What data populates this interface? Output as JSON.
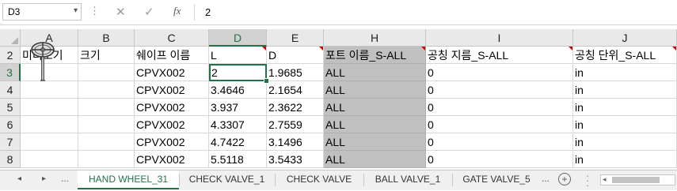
{
  "formula_bar": {
    "name_box": "D3",
    "name_box_arrow": "▾",
    "cancel_icon": "✕",
    "enter_icon": "✓",
    "fx_label": "fx",
    "formula_value": "2"
  },
  "columns": [
    "A",
    "B",
    "C",
    "D",
    "E",
    "H",
    "I",
    "J"
  ],
  "rows": [
    "2",
    "3",
    "4",
    "5",
    "6",
    "7",
    "8"
  ],
  "header_row": [
    "미리보기",
    "크기",
    "쉐이프 이름",
    "L",
    "D",
    "포트 이름_S-ALL",
    "공칭 지름_S-ALL",
    "공칭 단위_S-ALL"
  ],
  "data_rows": [
    [
      "",
      "",
      "CPVX002",
      "2",
      "1.9685",
      "ALL",
      "0",
      "in"
    ],
    [
      "",
      "",
      "CPVX002",
      "3.4646",
      "2.1654",
      "ALL",
      "0",
      "in"
    ],
    [
      "",
      "",
      "CPVX002",
      "3.937",
      "2.3622",
      "ALL",
      "0",
      "in"
    ],
    [
      "",
      "",
      "CPVX002",
      "4.3307",
      "2.7559",
      "ALL",
      "0",
      "in"
    ],
    [
      "",
      "",
      "CPVX002",
      "4.7422",
      "3.1496",
      "ALL",
      "0",
      "in"
    ],
    [
      "",
      "",
      "CPVX002",
      "5.5118",
      "3.5433",
      "ALL",
      "0",
      "in"
    ]
  ],
  "sheet_tabs": {
    "nav_prev": "◂",
    "nav_next": "▸",
    "more": "...",
    "tabs": [
      "HAND WHEEL_31",
      "CHECK VALVE_1",
      "CHECK VALVE",
      "BALL VALVE_1",
      "GATE VALVE_5"
    ],
    "more_right": "...",
    "add_icon": "+",
    "scroll_left": "◂"
  },
  "colors": {
    "accent": "#217346",
    "gray_column": "#c0c0c0",
    "comment_marker": "#d00000"
  }
}
